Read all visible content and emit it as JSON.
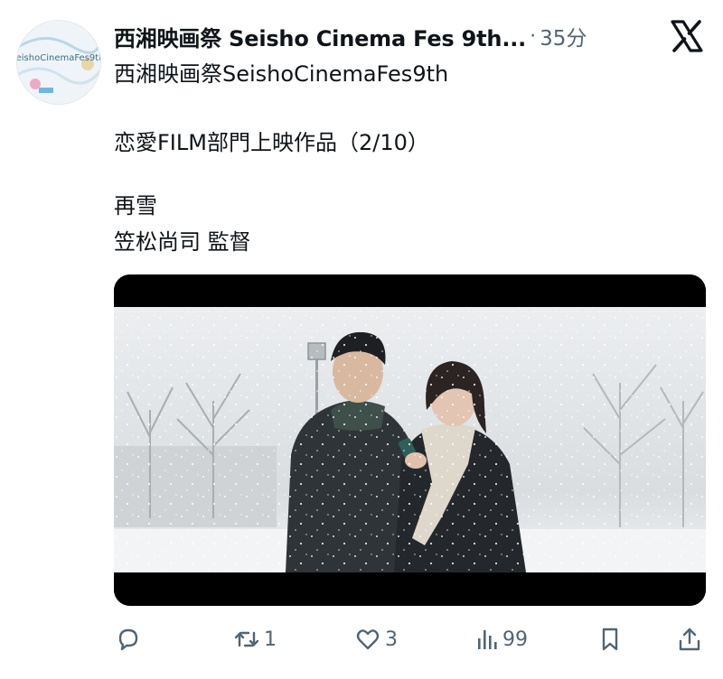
{
  "post": {
    "display_name": "西湘映画祭 Seisho Cinema Fes 9th...",
    "separator": "·",
    "time": "35分",
    "handle": "西湘映画祭SeishoCinemaFes9th",
    "lines": [
      "恋愛FILM部門上映作品（2/10）",
      "再雪",
      "笠松尚司 監督"
    ]
  },
  "avatar": {
    "logo_text": "SeishoCinemaFes9th."
  },
  "actions": {
    "reply_count": "",
    "repost_count": "1",
    "like_count": "3",
    "views_count": "99"
  },
  "icons": {
    "brand": "x-logo-icon",
    "reply": "reply-icon",
    "repost": "repost-icon",
    "like": "heart-icon",
    "views": "views-icon",
    "bookmark": "bookmark-icon",
    "share": "share-icon"
  },
  "colors": {
    "text": "#0f1419",
    "muted": "#536471",
    "letterbox": "#000000",
    "snow": "#dfe3e6"
  }
}
